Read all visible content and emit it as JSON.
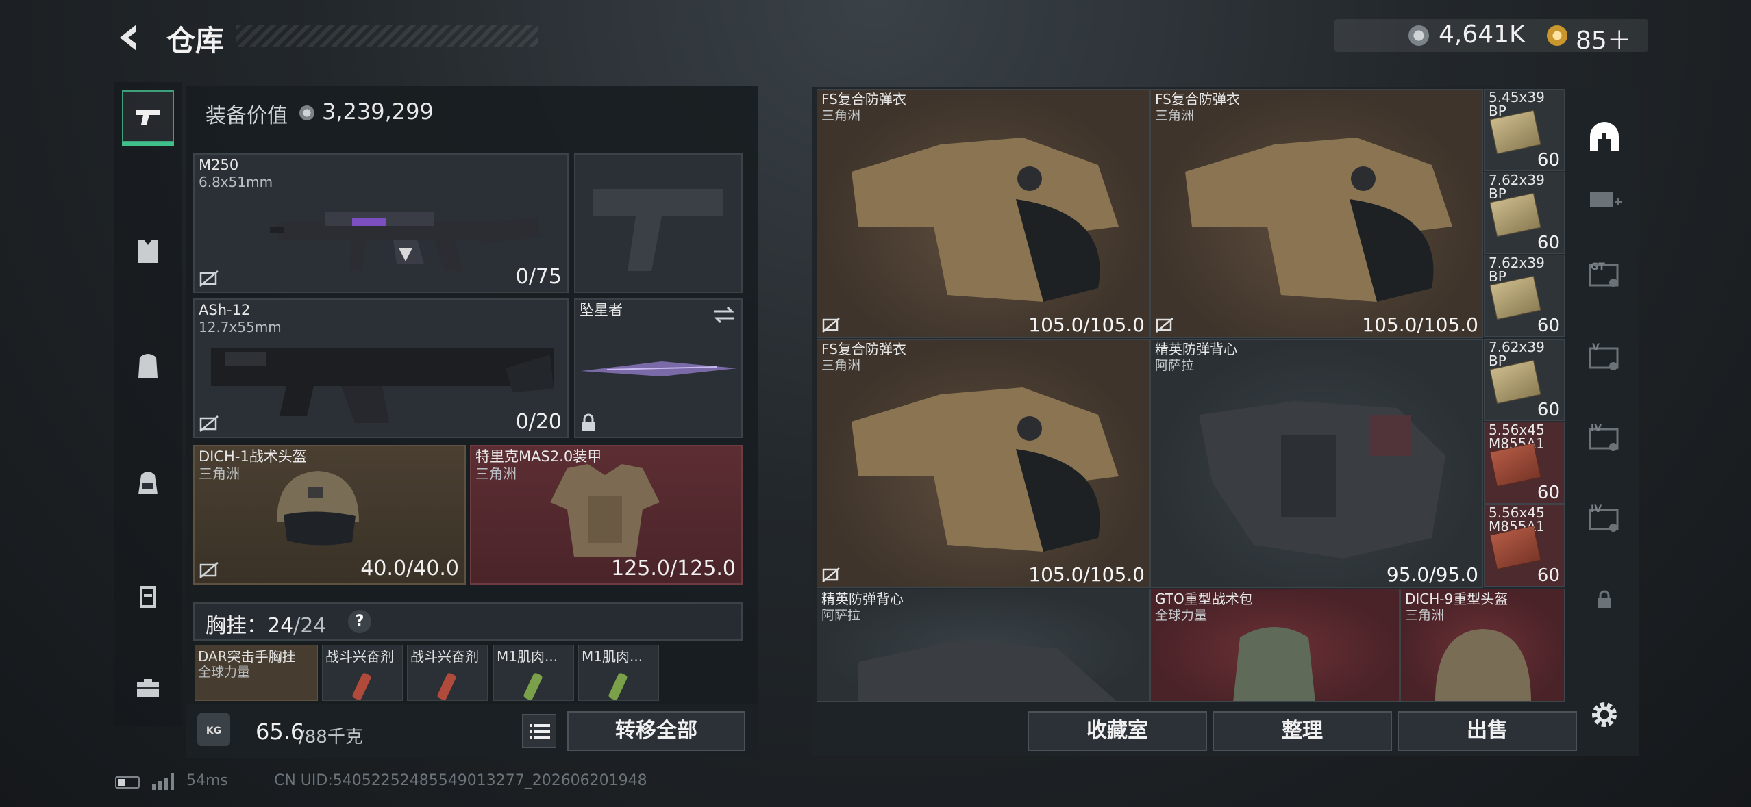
{
  "header": {
    "title": "仓库"
  },
  "currency": {
    "coins": "4,641K",
    "tokens": "85＋"
  },
  "left_rail": {
    "items": [
      {
        "id": "weapons",
        "icon": "pistol-icon"
      },
      {
        "id": "armor",
        "icon": "vest-icon"
      },
      {
        "id": "backpack",
        "icon": "backpack-icon"
      },
      {
        "id": "bag",
        "icon": "bag-icon"
      },
      {
        "id": "rig",
        "icon": "rig-icon"
      },
      {
        "id": "case",
        "icon": "briefcase-icon"
      }
    ]
  },
  "loadout": {
    "equip_label": "装备价值",
    "equip_value": "3,239,299",
    "primary": {
      "name": "M250",
      "caliber": "6.8x51mm",
      "ammo": "0/75"
    },
    "secondary": {
      "name": "ASh-12",
      "caliber": "12.7x55mm",
      "ammo": "0/20"
    },
    "melee": {
      "name": "坠星者"
    },
    "helmet": {
      "name": "DICH-1战术头盔",
      "brand": "三角洲",
      "durability": "40.0/40.0"
    },
    "armor": {
      "name": "特里克MAS2.0装甲",
      "brand": "三角洲",
      "durability": "125.0/125.0"
    },
    "chest_rig": {
      "label": "胸挂：",
      "current": "24",
      "max": "/24",
      "help": "?"
    },
    "chest_items": [
      {
        "name": "DAR突击手胸挂",
        "sub": "全球力量"
      },
      {
        "name": "战斗兴奋剂"
      },
      {
        "name": "战斗兴奋剂"
      },
      {
        "name": "M1肌肉..."
      },
      {
        "name": "M1肌肉..."
      }
    ],
    "weight": {
      "icon_label": "KG",
      "value": "65.6",
      "max": "/88千克"
    },
    "transfer_all": "转移全部"
  },
  "stash": {
    "items": [
      {
        "name": "FS复合防弹衣",
        "brand": "三角洲",
        "durability": "105.0/105.0"
      },
      {
        "name": "FS复合防弹衣",
        "brand": "三角洲",
        "durability": "105.0/105.0"
      },
      {
        "name": "FS复合防弹衣",
        "brand": "三角洲",
        "durability": "105.0/105.0"
      },
      {
        "name": "精英防弹背心",
        "brand": "阿萨拉",
        "durability": "95.0/95.0"
      },
      {
        "name": "精英防弹背心",
        "brand": "阿萨拉"
      },
      {
        "name": "GTO重型战术包",
        "brand": "全球力量"
      },
      {
        "name": "DICH-9重型头盔",
        "brand": "三角洲"
      }
    ],
    "ammo": [
      {
        "caliber": "5.45x39",
        "type": "BP",
        "count": "60"
      },
      {
        "caliber": "7.62x39",
        "type": "BP",
        "count": "60"
      },
      {
        "caliber": "7.62x39",
        "type": "BP",
        "count": "60"
      },
      {
        "caliber": "7.62x39",
        "type": "BP",
        "count": "60"
      },
      {
        "caliber": "5.56x45",
        "type": "M855A1",
        "count": "60"
      },
      {
        "caliber": "5.56x45",
        "type": "M855A1",
        "count": "60"
      }
    ],
    "buttons": {
      "collection": "收藏室",
      "sort": "整理",
      "sell": "出售"
    }
  },
  "right_rail": {
    "labels": {
      "gt": "GT",
      "v": "V",
      "iv1": "IV",
      "iv2": "IV"
    }
  },
  "footer": {
    "ping": "54ms",
    "uid": "CN UID:540522524855490132​77_202606201948"
  },
  "colors": {
    "accent": "#3fbf8a",
    "armor_red": "#5c2e33",
    "helmet_brown": "#4a3f31"
  }
}
